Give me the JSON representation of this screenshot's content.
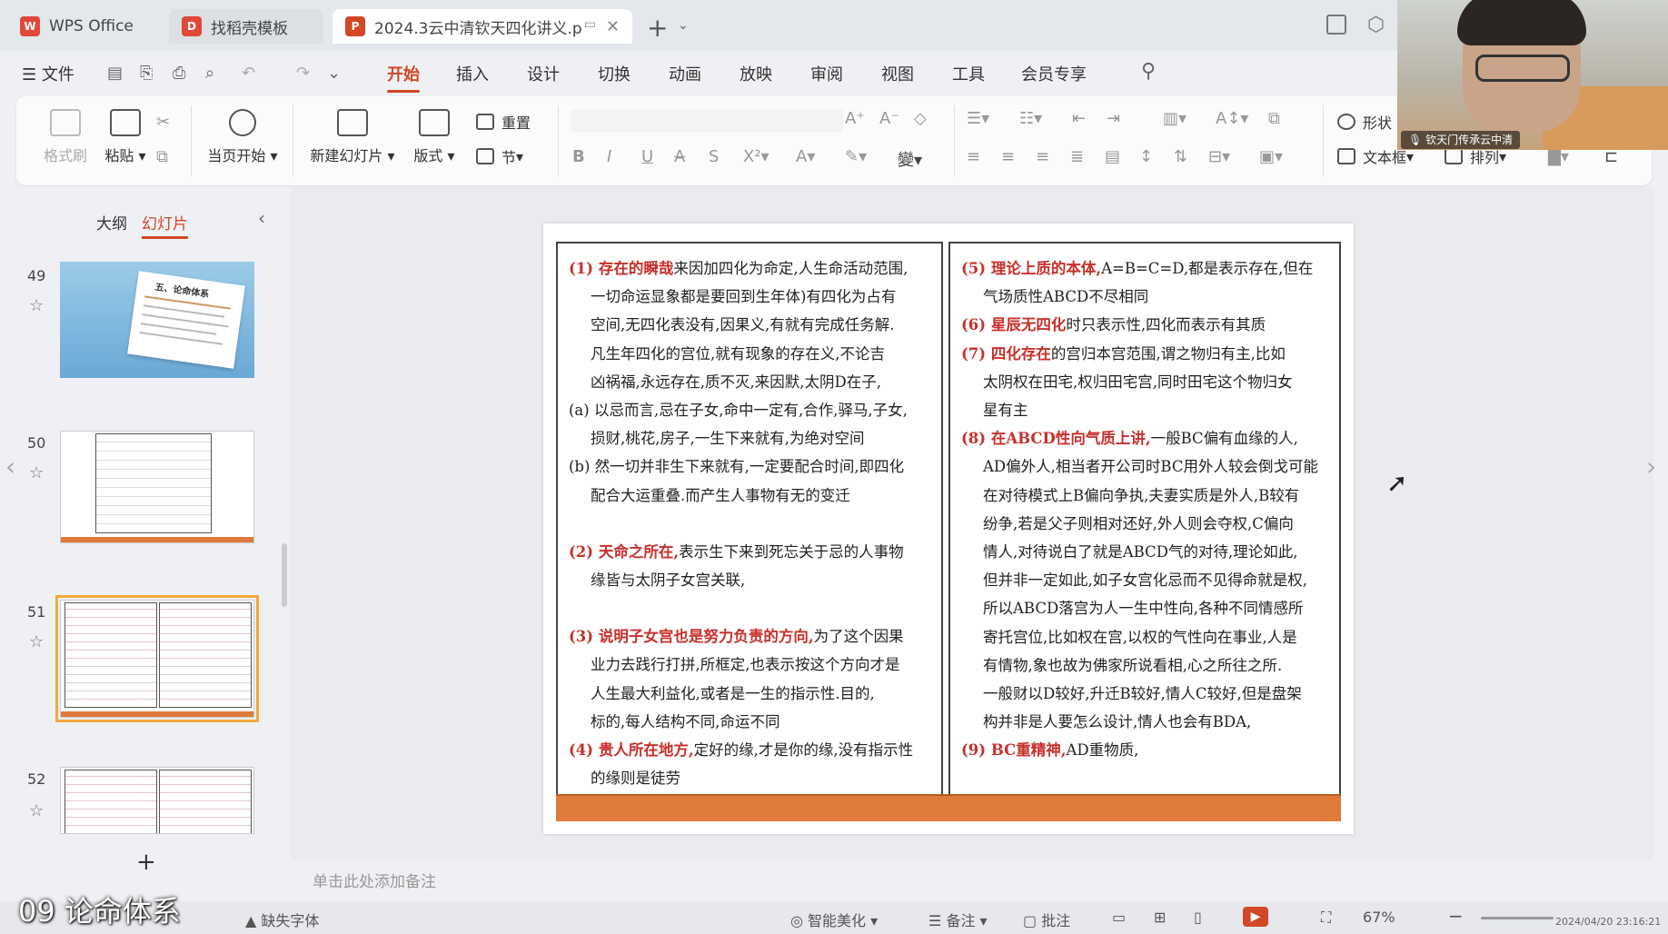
{
  "tabs": [
    {
      "label": "WPS Office"
    },
    {
      "label": "找稻壳模板"
    },
    {
      "label": "2024.3云中清钦天四化讲义.p"
    }
  ],
  "menu": {
    "file": "文件",
    "items": [
      "开始",
      "插入",
      "设计",
      "切换",
      "动画",
      "放映",
      "审阅",
      "视图",
      "工具",
      "会员专享"
    ]
  },
  "ribbon": {
    "format_painter": "格式刷",
    "paste": "粘贴",
    "from_current": "当页开始",
    "new_slide": "新建幻灯片",
    "layout": "版式",
    "reset": "重置",
    "section": "节",
    "shape": "形状",
    "textbox": "文本框",
    "arrange": "排列"
  },
  "webcam": {
    "caption": "钦天门传承云中清"
  },
  "left_panel": {
    "tab_outline": "大纲",
    "tab_slides": "幻灯片",
    "slides": [
      {
        "num": "49",
        "thumb_title": "五、论命体系"
      },
      {
        "num": "50"
      },
      {
        "num": "51"
      },
      {
        "num": "52"
      }
    ]
  },
  "slide": {
    "left": {
      "p1_title": "(1) 存在的瞬哉",
      "p1_lines": [
        "来因加四化为命定,人生命活动范围,",
        "一切命运显象都是要回到生年体)有四化为占有",
        "空间,无四化表没有,因果义,有就有完成任务解.",
        "凡生年四化的宫位,就有现象的存在义,不论吉",
        "凶祸福,永远存在,质不灭,来因默,太阴D在子,"
      ],
      "a_lines": [
        "(a) 以忌而言,忌在子女,命中一定有,合作,驿马,子女,",
        "损财,桃花,房子,一生下来就有,为绝对空间"
      ],
      "b_lines": [
        "(b) 然一切并非生下来就有,一定要配合时间,即四化",
        "配合大运重叠.而产生人事物有无的变迁"
      ],
      "p2_title": "(2) 天命之所在,",
      "p2_lines": [
        "表示生下来到死忘关于忌的人事物",
        "缘皆与太阴子女宫关联,"
      ],
      "p3_title": "(3) 说明子女宫也是努力负责的方向,",
      "p3_lines": [
        "为了这个因果",
        "业力去践行打拼,所框定,也表示按这个方向才是",
        "人生最大利益化,或者是一生的指示性.目的,",
        "标的,每人结构不同,命运不同"
      ],
      "p4_title": "(4) 贵人所在地方,",
      "p4_lines": [
        "定好的缘,才是你的缘,没有指示性",
        "的缘则是徒劳"
      ]
    },
    "right": {
      "p5_title": "(5) 理论上质的本体,",
      "p5_lines": [
        "A=B=C=D,都是表示存在,但在",
        "气场质性ABCD不尽相同"
      ],
      "p6_title": "(6) 星辰无四化",
      "p6_lines": [
        "时只表示性,四化而表示有其质"
      ],
      "p7_title": "(7) 四化存在",
      "p7_lines": [
        "的宫归本宫范围,谓之物归有主,比如",
        "太阴权在田宅,权归田宅宫,同时田宅这个物归女",
        "星有主"
      ],
      "p8_title": "(8) 在ABCD性向气质上讲,",
      "p8_lines": [
        "一般BC偏有血缘的人,",
        "AD偏外人,相当者开公司时BC用外人较会倒戈可能",
        "在对待模式上B偏向争执,夫妻实质是外人,B较有",
        "纷争,若是父子则相对还好,外人则会夺权,C偏向",
        "情人,对待说白了就是ABCD气的对待,理论如此,",
        "但并非一定如此,如子女宫化忌而不见得命就是权,",
        "所以ABCD落宫为人一生中性向,各种不同情感所",
        "寄托宫位,比如权在宫,以权的气性向在事业,人是",
        "有情物,象也故为佛家所说看相,心之所往之所.",
        "一般财以D较好,升迁B较好,情人C较好,但是盘架",
        "构并非是人要怎么设计,情人也会有BDA,"
      ],
      "p9_title": "(9) BC重精神,",
      "p9_lines": [
        "AD重物质,"
      ]
    }
  },
  "notes_placeholder": "单击此处添加备注",
  "status": {
    "missing_fonts": "缺失字体",
    "smart_beautify": "智能美化",
    "notes": "备注",
    "comments": "批注",
    "zoom": "67%"
  },
  "overlay_title": "09 论命体系",
  "timestamp": "2024/04/20 23:16:21",
  "colors": {
    "accent": "#d24726",
    "slide_red": "#c8302b",
    "slide_bar": "#e07a3b"
  }
}
